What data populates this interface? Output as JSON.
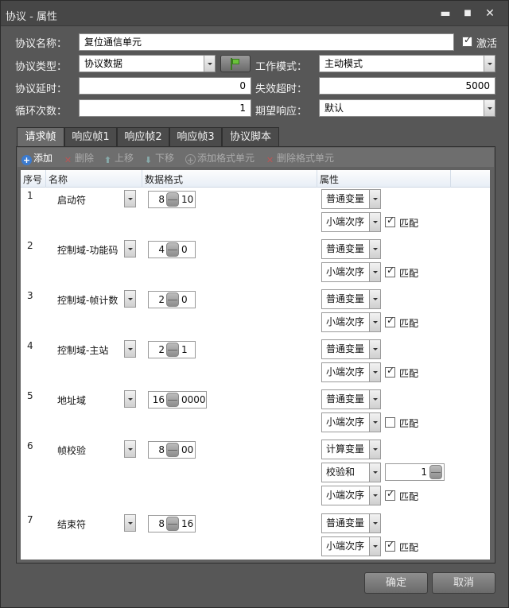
{
  "window": {
    "title": "协议 - 属性",
    "min": "▬",
    "max": "■",
    "close": "✕"
  },
  "form": {
    "name_label": "协议名称：",
    "name_value": "复位通信单元",
    "activate_label": "激活",
    "activate_checked": true,
    "type_label": "协议类型：",
    "type_value": "协议数据",
    "mode_label": "工作模式：",
    "mode_value": "主动模式",
    "delay_label": "协议延时：",
    "delay_value": "0",
    "timeout_label": "失效超时：",
    "timeout_value": "5000",
    "loop_label": "循环次数：",
    "loop_value": "1",
    "expect_label": "期望响应：",
    "expect_value": "默认"
  },
  "tabs": [
    "请求帧",
    "响应帧1",
    "响应帧2",
    "响应帧3",
    "协议脚本"
  ],
  "active_tab": 0,
  "toolbar": {
    "add": "添加",
    "delete": "删除",
    "up": "上移",
    "down": "下移",
    "add_fmt": "添加格式单元",
    "del_fmt": "删除格式单元"
  },
  "grid": {
    "headers": {
      "seq": "序号",
      "name": "名称",
      "format": "数据格式",
      "attr": "属性"
    },
    "rows": [
      {
        "seq": "1",
        "name": "启动符",
        "fmt_a": "8",
        "fmt_b": "10",
        "var": "普通变量",
        "order": "小端次序",
        "match": true
      },
      {
        "seq": "2",
        "name": "控制域-功能码",
        "fmt_a": "4",
        "fmt_b": "0",
        "var": "普通变量",
        "order": "小端次序",
        "match": true
      },
      {
        "seq": "3",
        "name": "控制域-帧计数",
        "fmt_a": "2",
        "fmt_b": "0",
        "var": "普通变量",
        "order": "小端次序",
        "match": true
      },
      {
        "seq": "4",
        "name": "控制域-主站",
        "fmt_a": "2",
        "fmt_b": "1",
        "var": "普通变量",
        "order": "小端次序",
        "match": true
      },
      {
        "seq": "5",
        "name": "地址域",
        "fmt_a": "16",
        "fmt_b": "0000",
        "var": "普通变量",
        "order": "小端次序",
        "match": false
      },
      {
        "seq": "6",
        "name": "帧校验",
        "fmt_a": "8",
        "fmt_b": "00",
        "var": "计算变量",
        "calc": "校验和",
        "calc_value": "1",
        "order": "小端次序",
        "match": true
      },
      {
        "seq": "7",
        "name": "结束符",
        "fmt_a": "8",
        "fmt_b": "16",
        "var": "普通变量",
        "order": "小端次序",
        "match": true
      }
    ],
    "match_label": "匹配"
  },
  "buttons": {
    "ok": "确定",
    "cancel": "取消"
  }
}
